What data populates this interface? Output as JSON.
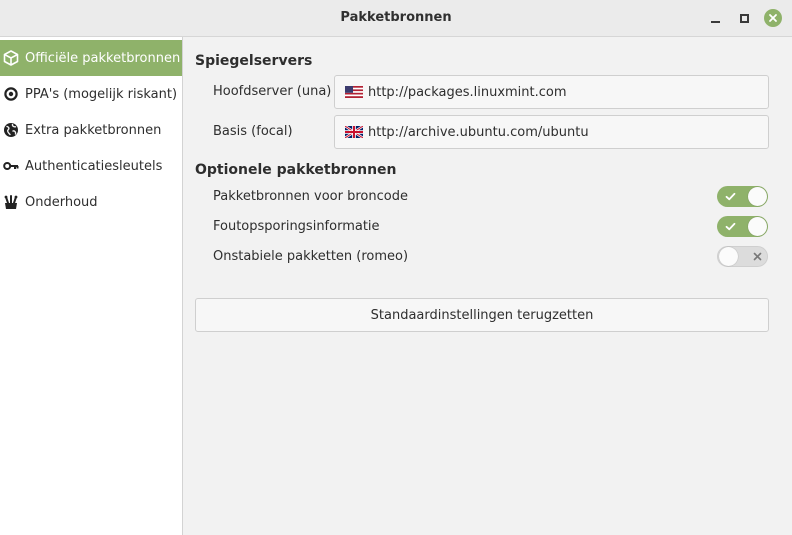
{
  "window": {
    "title": "Pakketbronnen",
    "close_color": "#8fb26a"
  },
  "sidebar": {
    "accent": "#8fb26a",
    "items": [
      {
        "label": "Officiële pakketbronnen",
        "icon": "package-icon",
        "active": true
      },
      {
        "label": "PPA's (mogelijk riskant)",
        "icon": "ppa-target-icon",
        "active": false
      },
      {
        "label": "Extra pakketbronnen",
        "icon": "globe-icon",
        "active": false
      },
      {
        "label": "Authenticatiesleutels",
        "icon": "key-icon",
        "active": false
      },
      {
        "label": "Onderhoud",
        "icon": "maintenance-icon",
        "active": false
      }
    ]
  },
  "mirrors": {
    "title": "Spiegelservers",
    "main": {
      "label": "Hoofdserver (una)",
      "url": "http://packages.linuxmint.com",
      "flag": "us-flag-icon"
    },
    "base": {
      "label": "Basis (focal)",
      "url": "http://archive.ubuntu.com/ubuntu",
      "flag": "uk-flag-icon"
    }
  },
  "optional": {
    "title": "Optionele pakketbronnen",
    "items": [
      {
        "label": "Pakketbronnen voor broncode",
        "enabled": true
      },
      {
        "label": "Foutopsporingsinformatie",
        "enabled": true
      },
      {
        "label": "Onstabiele pakketten (romeo)",
        "enabled": false
      }
    ]
  },
  "reset_label": "Standaardinstellingen terugzetten"
}
